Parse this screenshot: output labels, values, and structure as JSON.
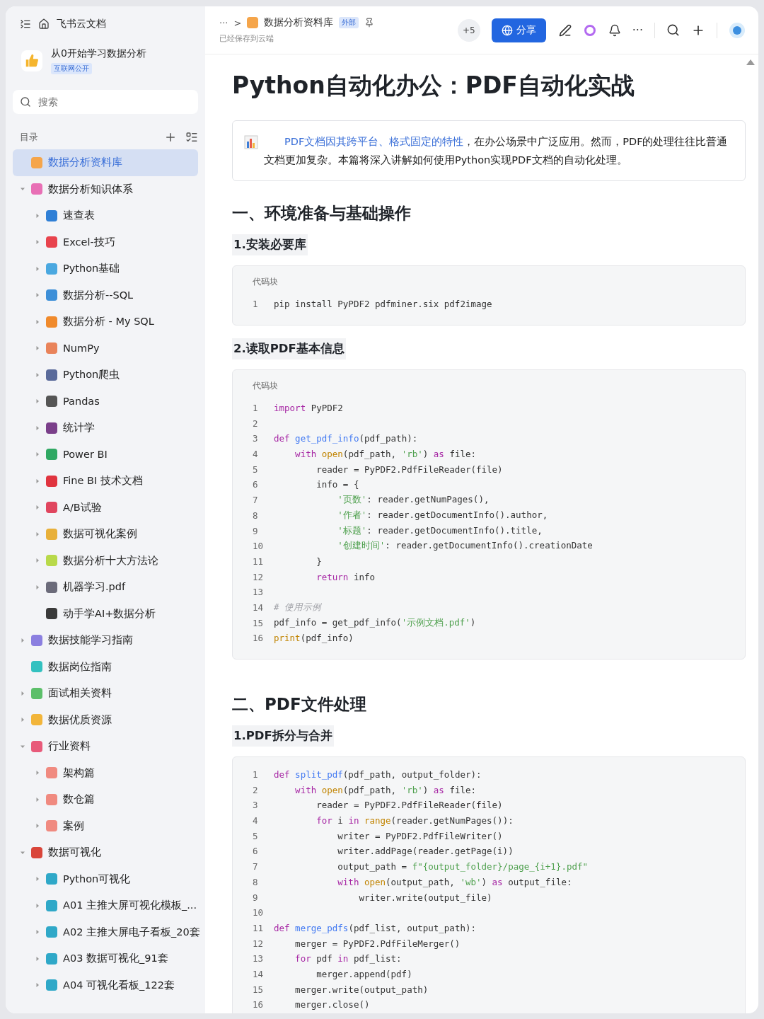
{
  "sidebar": {
    "header": {
      "title": "飞书云文档"
    },
    "space": {
      "title": "从0开始学习数据分析",
      "badge": "互联网公开"
    },
    "search": {
      "placeholder": "搜索"
    },
    "toc_label": "目录",
    "items": [
      {
        "label": "数据分析资料库",
        "color": "#f5a54a",
        "selected": true
      },
      {
        "label": "数据分析知识体系",
        "color": "#e86fb5",
        "selected": false,
        "expanded": true,
        "children": [
          {
            "label": "速查表",
            "color": "#2f7fd6",
            "selected": false,
            "expanded": false
          },
          {
            "label": "Excel-技巧",
            "color": "#e8434d",
            "selected": false,
            "expanded": false
          },
          {
            "label": "Python基础",
            "color": "#4aa8e0",
            "selected": false,
            "expanded": false
          },
          {
            "label": "数据分析--SQL",
            "color": "#3d8fd8",
            "selected": false,
            "expanded": false
          },
          {
            "label": "数据分析 - My SQL",
            "color": "#f08a2c",
            "selected": false,
            "expanded": false
          },
          {
            "label": "NumPy",
            "color": "#e9835a",
            "selected": false,
            "expanded": false
          },
          {
            "label": "Python爬虫",
            "color": "#5a6a9a",
            "selected": false,
            "expanded": false
          },
          {
            "label": "Pandas",
            "color": "#555555",
            "selected": false,
            "expanded": false
          },
          {
            "label": "统计学",
            "color": "#7a3f8a",
            "selected": false,
            "expanded": false
          },
          {
            "label": "Power BI",
            "color": "#2fa863",
            "selected": false,
            "expanded": false
          },
          {
            "label": "Fine BI 技术文档",
            "color": "#e0343f",
            "selected": false,
            "expanded": false
          },
          {
            "label": "A/B试验",
            "color": "#e0455e",
            "selected": false,
            "expanded": false
          },
          {
            "label": "数据可视化案例",
            "color": "#e8b03a",
            "selected": false,
            "expanded": false
          },
          {
            "label": "数据分析十大方法论",
            "color": "#b8d94a",
            "selected": false,
            "expanded": false
          },
          {
            "label": "机器学习.pdf",
            "color": "#6b6b7a",
            "selected": false,
            "expanded": false
          },
          {
            "label": "动手学AI+数据分析",
            "color": "#3a3a3a",
            "selected": false
          }
        ]
      },
      {
        "label": "数据技能学习指南",
        "color": "#8b7fe0",
        "selected": false,
        "expanded": false
      },
      {
        "label": "数据岗位指南",
        "color": "#33c1c0",
        "selected": false
      },
      {
        "label": "面试相关资料",
        "color": "#5cbf6a",
        "selected": false,
        "expanded": false
      },
      {
        "label": "数据优质资源",
        "color": "#f2b53a",
        "selected": false,
        "expanded": false
      },
      {
        "label": "行业资料",
        "color": "#e85a7a",
        "selected": false,
        "expanded": true,
        "children": [
          {
            "label": "架构篇",
            "color": "#f08a80",
            "selected": false,
            "expanded": false
          },
          {
            "label": "数仓篇",
            "color": "#f08a80",
            "selected": false,
            "expanded": false
          },
          {
            "label": "案例",
            "color": "#f08a80",
            "selected": false,
            "expanded": false
          }
        ]
      },
      {
        "label": "数据可视化",
        "color": "#d9453a",
        "selected": false,
        "expanded": true,
        "children": [
          {
            "label": "Python可视化",
            "color": "#2fa8c8",
            "selected": false,
            "expanded": false
          },
          {
            "label": "A01 主推大屏可视化模板_...",
            "color": "#2fa8c8",
            "selected": false,
            "expanded": false
          },
          {
            "label": "A02 主推大屏电子看板_20套",
            "color": "#2fa8c8",
            "selected": false,
            "expanded": false
          },
          {
            "label": "A03 数据可视化_91套",
            "color": "#2fa8c8",
            "selected": false,
            "expanded": false
          },
          {
            "label": "A04 可视化看板_122套",
            "color": "#2fa8c8",
            "selected": false,
            "expanded": false
          }
        ]
      }
    ]
  },
  "topbar": {
    "more": "···",
    "crumb_sep": ">",
    "crumb": "数据分析资料库",
    "crumb_badge": "外部",
    "saved": "已经保存到云端",
    "collaborators": "+5",
    "share": "分享",
    "menu": "···"
  },
  "doc": {
    "title": "Python自动化办公：PDF自动化实战",
    "callout": {
      "lead": "PDF文档因其跨平台、格式固定的特性",
      "text": "，在办公场景中广泛应用。然而，PDF的处理往往比普通文档更加复杂。本篇将深入讲解如何使用Python实现PDF文档的自动化处理。"
    },
    "sections": [
      {
        "kind": "h2",
        "text": "一、环境准备与基础操作"
      },
      {
        "kind": "h3",
        "text": "1.安装必要库"
      },
      {
        "kind": "code",
        "label": "代码块",
        "lines": [
          {
            "n": "1",
            "code": [
              {
                "kind": "plain",
                "text": "pip install PyPDF2 pdfminer.six pdf2image"
              }
            ]
          }
        ]
      },
      {
        "kind": "h3",
        "text": "2.读取PDF基本信息"
      },
      {
        "kind": "code",
        "label": "代码块",
        "lines": [
          {
            "n": "1",
            "code": [
              {
                "kind": "keyword",
                "text": "import"
              },
              {
                "kind": "plain",
                "text": " PyPDF2"
              }
            ]
          },
          {
            "n": "2"
          },
          {
            "n": "3",
            "code": [
              {
                "kind": "keyword",
                "text": "def"
              },
              {
                "kind": "function",
                "text": " get_pdf_info"
              },
              {
                "kind": "plain",
                "text": "(pdf_path):"
              }
            ]
          },
          {
            "n": "4",
            "code": [
              {
                "kind": "keyword",
                "text": "    with"
              },
              {
                "kind": "builtin",
                "text": " open"
              },
              {
                "kind": "plain",
                "text": "(pdf_path, "
              },
              {
                "kind": "string",
                "text": "'rb'"
              },
              {
                "kind": "plain",
                "text": ") "
              },
              {
                "kind": "keyword",
                "text": "as"
              },
              {
                "kind": "plain",
                "text": " file:"
              }
            ]
          },
          {
            "n": "5",
            "code": [
              {
                "kind": "plain",
                "text": "        reader = PyPDF2.PdfFileReader(file)"
              }
            ]
          },
          {
            "n": "6",
            "code": [
              {
                "kind": "plain",
                "text": "        info = {"
              }
            ]
          },
          {
            "n": "7",
            "code": [
              {
                "kind": "string",
                "text": "            '页数'"
              },
              {
                "kind": "plain",
                "text": ": reader.getNumPages(),"
              }
            ]
          },
          {
            "n": "8",
            "code": [
              {
                "kind": "string",
                "text": "            '作者'"
              },
              {
                "kind": "plain",
                "text": ": reader.getDocumentInfo().author,"
              }
            ]
          },
          {
            "n": "9",
            "code": [
              {
                "kind": "string",
                "text": "            '标题'"
              },
              {
                "kind": "plain",
                "text": ": reader.getDocumentInfo().title,"
              }
            ]
          },
          {
            "n": "10",
            "code": [
              {
                "kind": "string",
                "text": "            '创建时间'"
              },
              {
                "kind": "plain",
                "text": ": reader.getDocumentInfo().creationDate"
              }
            ]
          },
          {
            "n": "11",
            "code": [
              {
                "kind": "plain",
                "text": "        }"
              }
            ]
          },
          {
            "n": "12",
            "code": [
              {
                "kind": "keyword",
                "text": "        return"
              },
              {
                "kind": "plain",
                "text": " info"
              }
            ]
          },
          {
            "n": "13"
          },
          {
            "n": "14",
            "code": [
              {
                "kind": "comment",
                "text": "# 使用示例"
              }
            ]
          },
          {
            "n": "15",
            "code": [
              {
                "kind": "plain",
                "text": "pdf_info = get_pdf_info("
              },
              {
                "kind": "string",
                "text": "'示例文档.pdf'"
              },
              {
                "kind": "plain",
                "text": ")"
              }
            ]
          },
          {
            "n": "16",
            "code": [
              {
                "kind": "builtin",
                "text": "print"
              },
              {
                "kind": "plain",
                "text": "(pdf_info)"
              }
            ]
          }
        ]
      },
      {
        "kind": "h2",
        "text": "二、PDF文件处理"
      },
      {
        "kind": "h3",
        "text": "1.PDF拆分与合并"
      },
      {
        "kind": "code",
        "lines": [
          {
            "n": "1",
            "code": [
              {
                "kind": "keyword",
                "text": "def"
              },
              {
                "kind": "function",
                "text": " split_pdf"
              },
              {
                "kind": "plain",
                "text": "(pdf_path, output_folder):"
              }
            ]
          },
          {
            "n": "2",
            "code": [
              {
                "kind": "keyword",
                "text": "    with"
              },
              {
                "kind": "builtin",
                "text": " open"
              },
              {
                "kind": "plain",
                "text": "(pdf_path, "
              },
              {
                "kind": "string",
                "text": "'rb'"
              },
              {
                "kind": "plain",
                "text": ") "
              },
              {
                "kind": "keyword",
                "text": "as"
              },
              {
                "kind": "plain",
                "text": " file:"
              }
            ]
          },
          {
            "n": "3",
            "code": [
              {
                "kind": "plain",
                "text": "        reader = PyPDF2.PdfFileReader(file)"
              }
            ]
          },
          {
            "n": "4",
            "code": [
              {
                "kind": "keyword",
                "text": "        for"
              },
              {
                "kind": "plain",
                "text": " i "
              },
              {
                "kind": "keyword",
                "text": "in"
              },
              {
                "kind": "builtin",
                "text": " range"
              },
              {
                "kind": "plain",
                "text": "(reader.getNumPages()):"
              }
            ]
          },
          {
            "n": "5",
            "code": [
              {
                "kind": "plain",
                "text": "            writer = PyPDF2.PdfFileWriter()"
              }
            ]
          },
          {
            "n": "6",
            "code": [
              {
                "kind": "plain",
                "text": "            writer.addPage(reader.getPage(i))"
              }
            ]
          },
          {
            "n": "7",
            "code": [
              {
                "kind": "plain",
                "text": "            output_path = "
              },
              {
                "kind": "string",
                "text": "f\"{output_folder}/page_{i+1}.pdf\""
              }
            ]
          },
          {
            "n": "8",
            "code": [
              {
                "kind": "keyword",
                "text": "            with"
              },
              {
                "kind": "builtin",
                "text": " open"
              },
              {
                "kind": "plain",
                "text": "(output_path, "
              },
              {
                "kind": "string",
                "text": "'wb'"
              },
              {
                "kind": "plain",
                "text": ") "
              },
              {
                "kind": "keyword",
                "text": "as"
              },
              {
                "kind": "plain",
                "text": " output_file:"
              }
            ]
          },
          {
            "n": "9",
            "code": [
              {
                "kind": "plain",
                "text": "                writer.write(output_file)"
              }
            ]
          },
          {
            "n": "10"
          },
          {
            "n": "11",
            "code": [
              {
                "kind": "keyword",
                "text": "def"
              },
              {
                "kind": "function",
                "text": " merge_pdfs"
              },
              {
                "kind": "plain",
                "text": "(pdf_list, output_path):"
              }
            ]
          },
          {
            "n": "12",
            "code": [
              {
                "kind": "plain",
                "text": "    merger = PyPDF2.PdfFileMerger()"
              }
            ]
          },
          {
            "n": "13",
            "code": [
              {
                "kind": "keyword",
                "text": "    for"
              },
              {
                "kind": "plain",
                "text": " pdf "
              },
              {
                "kind": "keyword",
                "text": "in"
              },
              {
                "kind": "plain",
                "text": " pdf_list:"
              }
            ]
          },
          {
            "n": "14",
            "code": [
              {
                "kind": "plain",
                "text": "        merger.append(pdf)"
              }
            ]
          },
          {
            "n": "15",
            "code": [
              {
                "kind": "plain",
                "text": "    merger.write(output_path)"
              }
            ]
          },
          {
            "n": "16",
            "code": [
              {
                "kind": "plain",
                "text": "    merger.close()"
              }
            ]
          }
        ]
      }
    ]
  }
}
